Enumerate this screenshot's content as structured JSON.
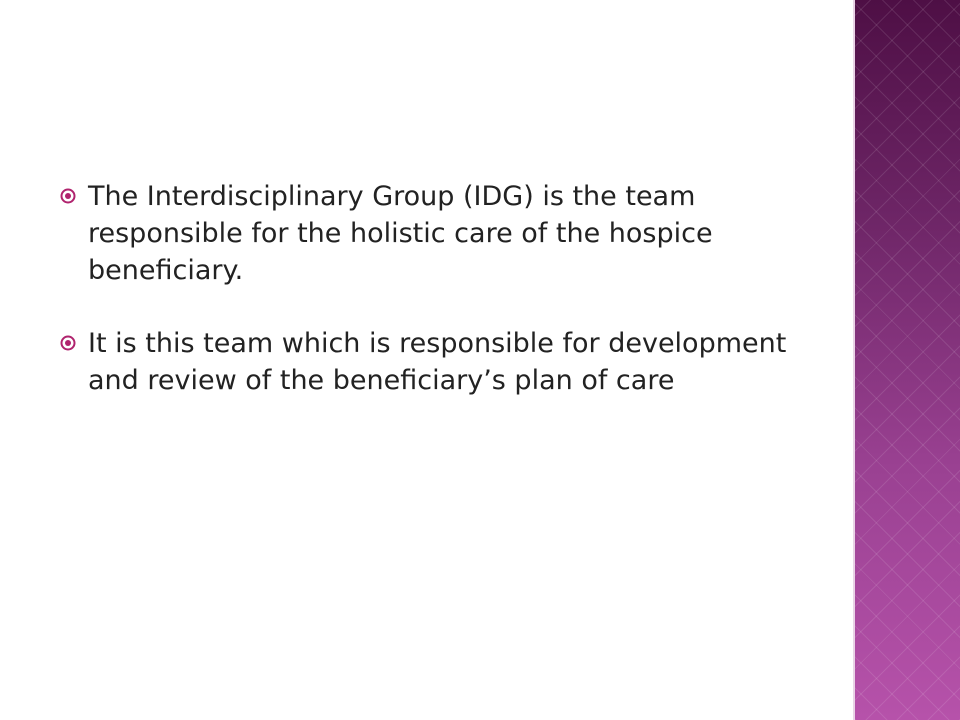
{
  "slide": {
    "accent_color": "#b0236e",
    "side_panel_colors": [
      "#4e0f45",
      "#b652aa"
    ],
    "bullets": [
      {
        "icon": "circled-dot-bullet-icon",
        "text": "The Interdisciplinary Group (IDG) is the team responsible for the holistic care of the hospice beneficiary."
      },
      {
        "icon": "circled-dot-bullet-icon",
        "text": "It is this team which is responsible for development and review of the beneficiary’s plan of care"
      }
    ]
  }
}
